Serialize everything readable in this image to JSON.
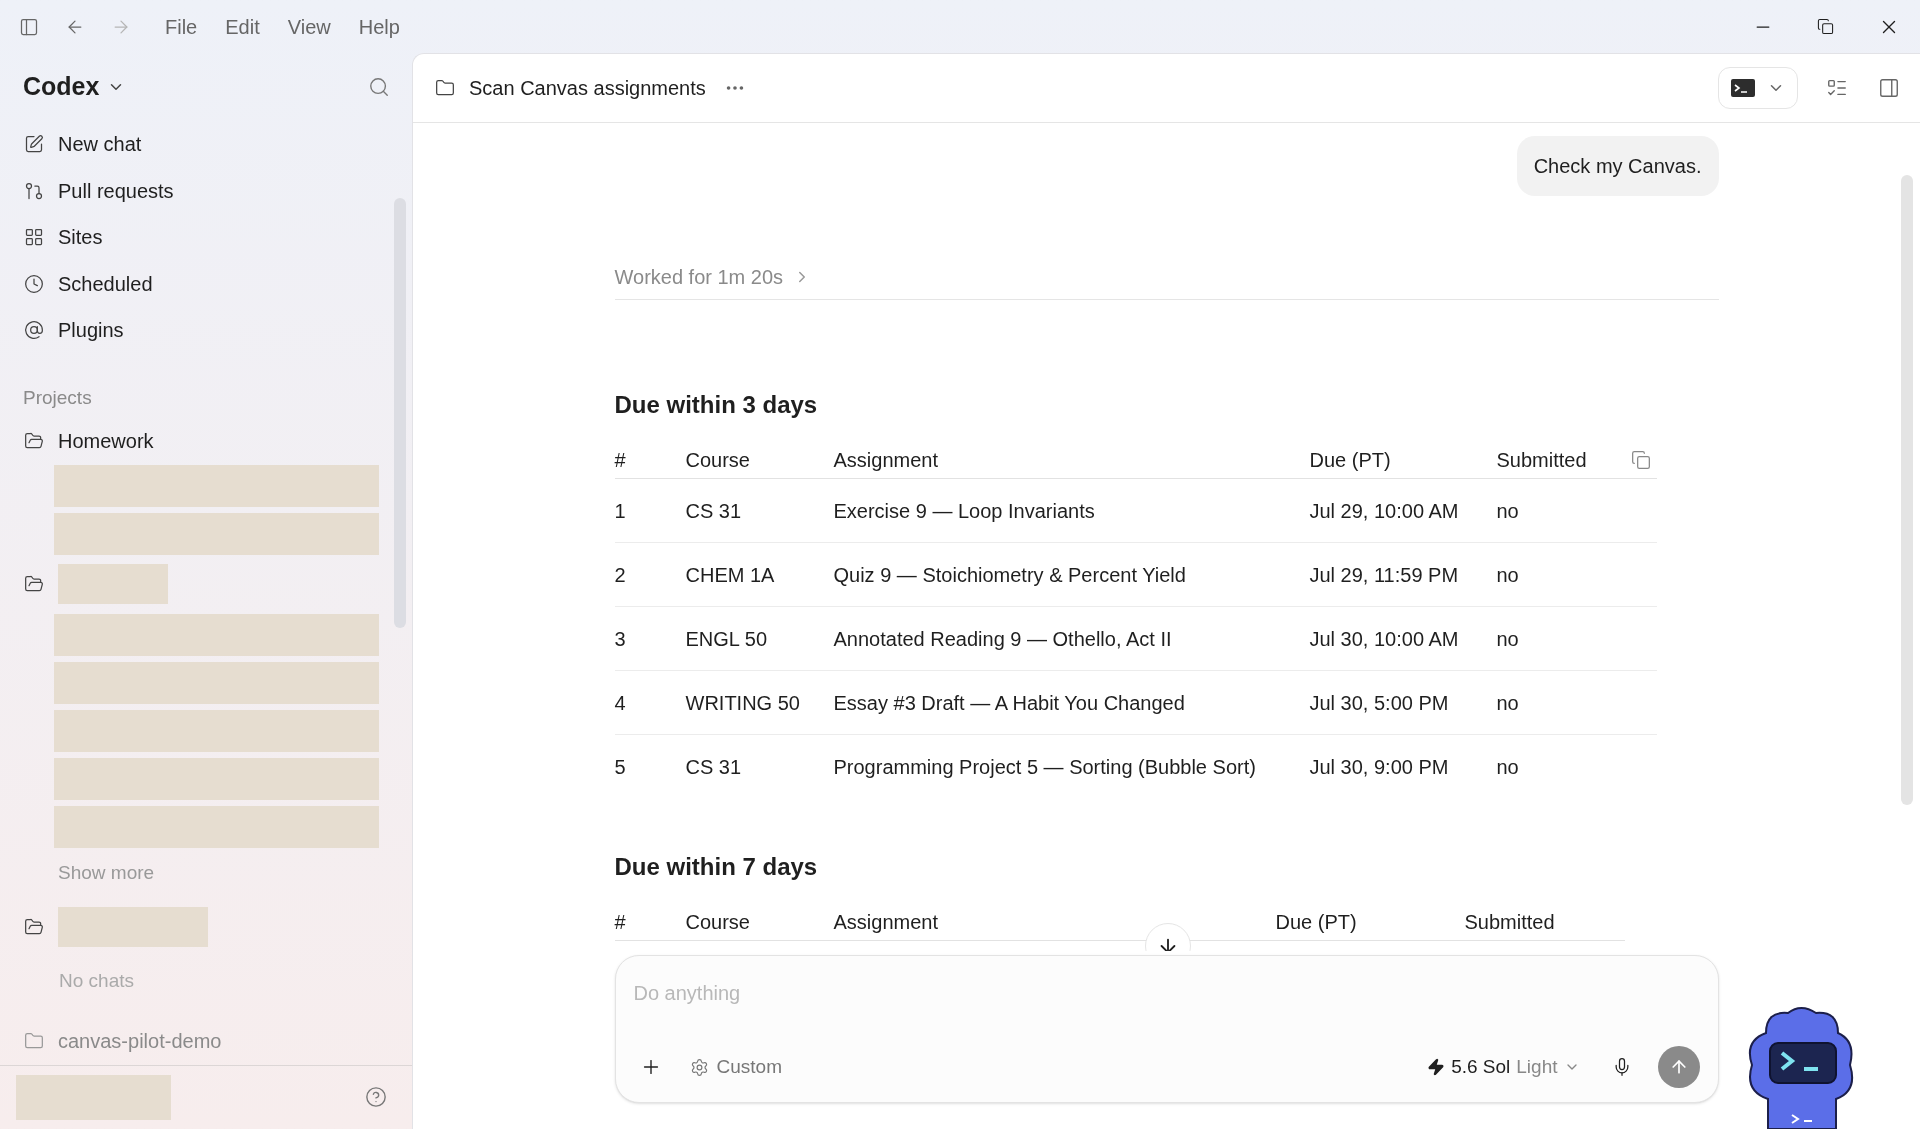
{
  "menu": [
    "File",
    "Edit",
    "View",
    "Help"
  ],
  "sidebar": {
    "title": "Codex",
    "nav": [
      {
        "kind": "new",
        "label": "New chat"
      },
      {
        "kind": "pulls",
        "label": "Pull requests"
      },
      {
        "kind": "sites",
        "label": "Sites"
      },
      {
        "kind": "scheduled",
        "label": "Scheduled"
      },
      {
        "kind": "plugins",
        "label": "Plugins"
      }
    ],
    "projects_label": "Projects",
    "projects": [
      {
        "kind": "named",
        "name": "Homework",
        "chats": [
          {
            "kind": "redacted"
          },
          {
            "kind": "redacted"
          }
        ]
      },
      {
        "kind": "redacted",
        "chats": [
          {
            "kind": "redacted"
          },
          {
            "kind": "redacted"
          },
          {
            "kind": "redacted"
          },
          {
            "kind": "redacted"
          },
          {
            "kind": "redacted"
          }
        ],
        "show_more": "Show more"
      },
      {
        "kind": "redacted",
        "empty_text": "No chats"
      },
      {
        "kind": "named",
        "name": "canvas-pilot-demo"
      }
    ],
    "account": {
      "kind": "redacted"
    }
  },
  "thread": {
    "title": "Scan Canvas assignments",
    "user_message": "Check my Canvas.",
    "worked": "Worked for 1m 20s",
    "sections": [
      {
        "heading": "Due within 3 days",
        "copy_button": true,
        "columns": [
          "#",
          "Course",
          "Assignment",
          "Due (PT)",
          "Submitted"
        ],
        "rows": [
          [
            "1",
            "CS 31",
            "Exercise 9 — Loop Invariants",
            "Jul 29, 10:00 AM",
            "no"
          ],
          [
            "2",
            "CHEM 1A",
            "Quiz 9 — Stoichiometry & Percent Yield",
            "Jul 29, 11:59 PM",
            "no"
          ],
          [
            "3",
            "ENGL 50",
            "Annotated Reading 9 — Othello, Act II",
            "Jul 30, 10:00 AM",
            "no"
          ],
          [
            "4",
            "WRITING 50",
            "Essay #3 Draft — A Habit You Changed",
            "Jul 30, 5:00 PM",
            "no"
          ],
          [
            "5",
            "CS 31",
            "Programming Project 5 — Sorting (Bubble Sort)",
            "Jul 30, 9:00 PM",
            "no"
          ]
        ]
      },
      {
        "heading": "Due within 7 days",
        "copy_button": false,
        "columns": [
          "#",
          "Course",
          "Assignment",
          "Due (PT)",
          "Submitted"
        ]
      }
    ]
  },
  "composer": {
    "placeholder": "Do anything",
    "mode": "Custom",
    "model": "5.6 Sol",
    "effort": "Light"
  }
}
